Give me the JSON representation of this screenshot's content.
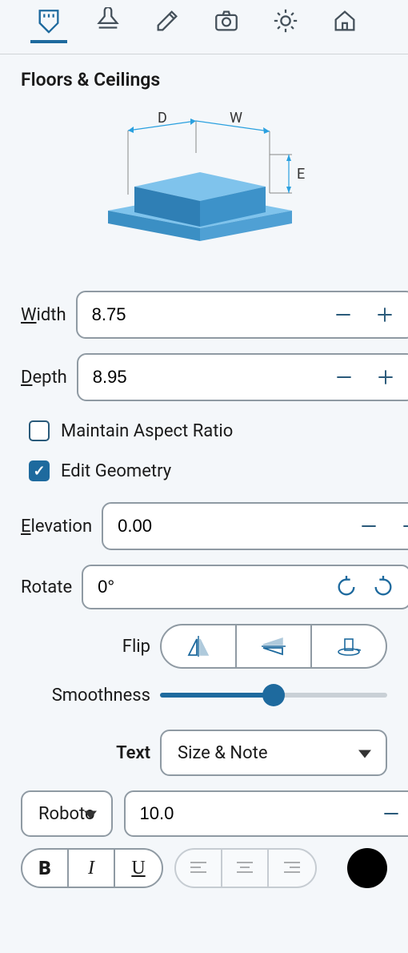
{
  "panel_title": "Floors & Ceilings",
  "diagram_labels": {
    "d": "D",
    "w": "W",
    "e": "E"
  },
  "width": {
    "label": "Width",
    "value": "8.75"
  },
  "depth": {
    "label": "Depth",
    "value": "8.95"
  },
  "maintain_ar": {
    "label": "Maintain Aspect Ratio",
    "checked": false
  },
  "edit_geom": {
    "label": "Edit Geometry",
    "checked": true
  },
  "elevation": {
    "label": "Elevation",
    "value": "0.00"
  },
  "rotate": {
    "label": "Rotate",
    "value": "0°"
  },
  "flip": {
    "label": "Flip"
  },
  "smoothness": {
    "label": "Smoothness",
    "percent": 50
  },
  "text": {
    "label": "Text",
    "value": "Size & Note"
  },
  "font": {
    "value": "Roboto"
  },
  "font_size": {
    "value": "10.0"
  },
  "styles": {
    "bold": "B",
    "italic": "I",
    "underline": "U"
  },
  "color": "#000000"
}
